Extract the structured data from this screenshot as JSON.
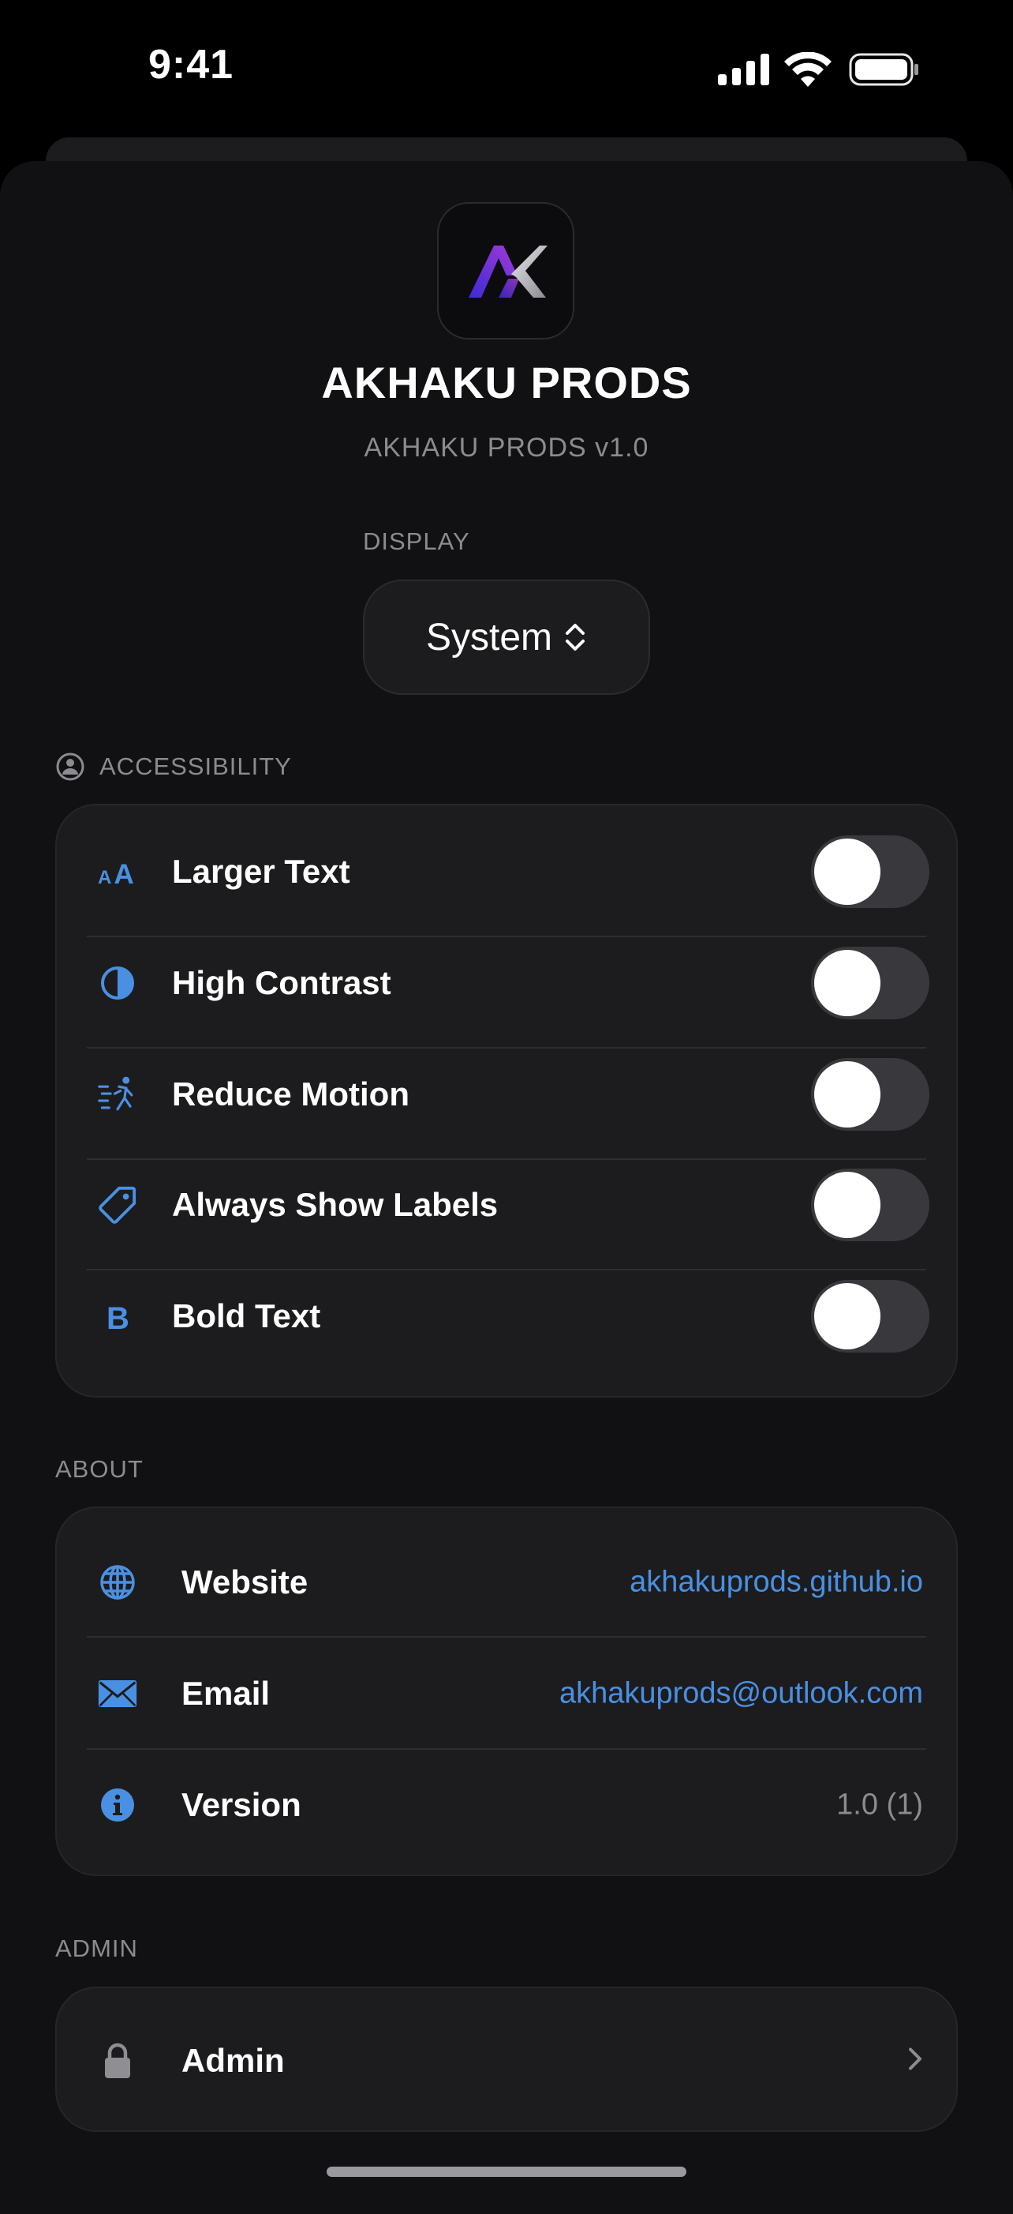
{
  "status_bar": {
    "time": "9:41"
  },
  "app": {
    "title": "AKHAKU PRODS",
    "subtitle": "AKHAKU PRODS v1.0"
  },
  "display": {
    "section_label": "DISPLAY",
    "selected": "System"
  },
  "accessibility": {
    "section_label": "ACCESSIBILITY",
    "rows": [
      {
        "label": "Larger Text",
        "icon": "text-size-icon",
        "on": false
      },
      {
        "label": "High Contrast",
        "icon": "contrast-icon",
        "on": false
      },
      {
        "label": "Reduce Motion",
        "icon": "motion-figure-icon",
        "on": false
      },
      {
        "label": "Always Show Labels",
        "icon": "tag-icon",
        "on": false
      },
      {
        "label": "Bold Text",
        "icon": "bold-icon",
        "on": false
      }
    ]
  },
  "about": {
    "section_label": "ABOUT",
    "rows": [
      {
        "label": "Website",
        "value": "akhakuprods.github.io",
        "icon": "globe-icon"
      },
      {
        "label": "Email",
        "value": "akhakuprods@outlook.com",
        "icon": "envelope-icon"
      },
      {
        "label": "Version",
        "value": "1.0 (1)",
        "icon": "info-icon"
      }
    ]
  },
  "admin": {
    "section_label": "ADMIN",
    "label": "Admin",
    "icon": "lock-icon"
  },
  "colors": {
    "accent": "#4a90e2",
    "background": "#000000",
    "card": "#1c1c1e",
    "secondary_text": "#8b8b90"
  }
}
